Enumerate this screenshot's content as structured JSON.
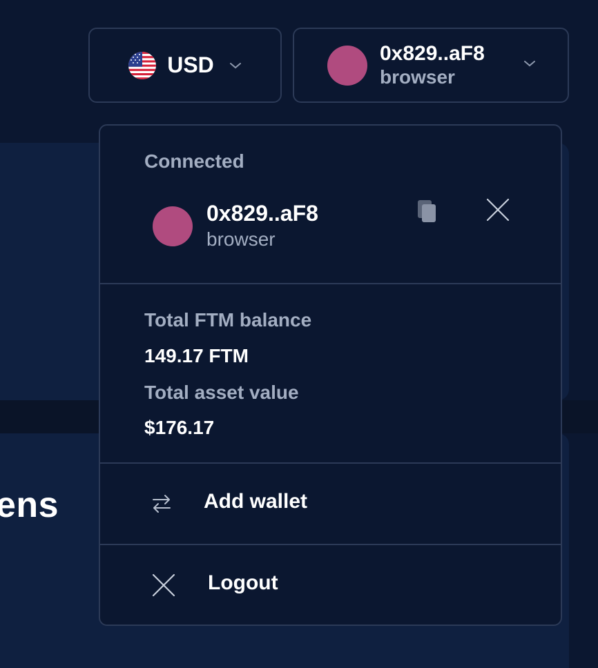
{
  "background": {
    "heading_fragment": "ens"
  },
  "header": {
    "currency": {
      "flag_icon": "us-flag-icon",
      "label": "USD",
      "chevron_icon": "chevron-down-icon"
    },
    "wallet": {
      "avatar_color": "#b04b7f",
      "address": "0x829..aF8",
      "type": "browser",
      "chevron_icon": "chevron-down-icon"
    }
  },
  "dropdown": {
    "connected_label": "Connected",
    "account": {
      "avatar_color": "#b04b7f",
      "address": "0x829..aF8",
      "type": "browser",
      "copy_icon": "copy-icon",
      "disconnect_icon": "close-icon"
    },
    "balance": {
      "ftm_label": "Total FTM balance",
      "ftm_value": "149.17 FTM",
      "asset_label": "Total asset value",
      "asset_value": "$176.17"
    },
    "menu": [
      {
        "label": "Add wallet",
        "icon": "swap-arrows-icon"
      },
      {
        "label": "Logout",
        "icon": "close-icon"
      }
    ]
  },
  "colors": {
    "page_bg": "#0b1730",
    "card_bg": "#0f2040",
    "border": "#2c3a57",
    "muted_text": "#a3aec2",
    "avatar": "#b04b7f"
  }
}
